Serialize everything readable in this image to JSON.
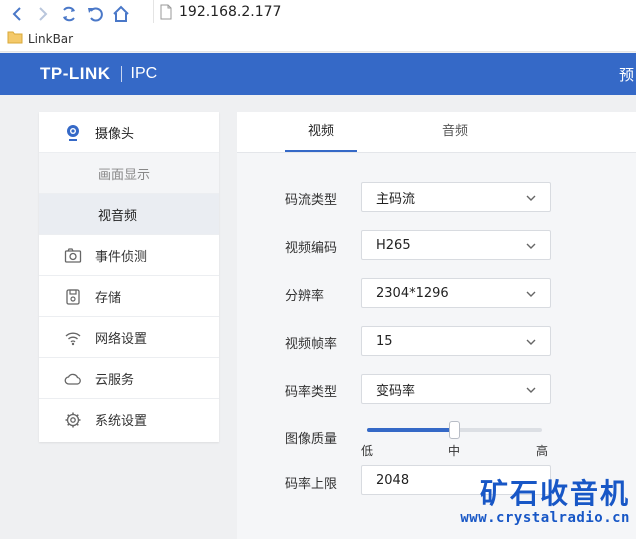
{
  "browser": {
    "url": "192.168.2.177",
    "bookmark_folder": "LinkBar"
  },
  "header": {
    "brand": "TP-LINK",
    "product": "IPC",
    "right_text": "预"
  },
  "sidebar": {
    "items": [
      {
        "label": "摄像头",
        "icon": "camera-icon"
      },
      {
        "label": "画面显示"
      },
      {
        "label": "视音频"
      },
      {
        "label": "事件侦测",
        "icon": "snapshot-camera-icon"
      },
      {
        "label": "存储",
        "icon": "disk-icon"
      },
      {
        "label": "网络设置",
        "icon": "wifi-icon"
      },
      {
        "label": "云服务",
        "icon": "cloud-icon"
      },
      {
        "label": "系统设置",
        "icon": "gear-icon"
      }
    ]
  },
  "tabs": [
    {
      "label": "视频"
    },
    {
      "label": "音频"
    }
  ],
  "form": {
    "stream_type": {
      "label": "码流类型",
      "value": "主码流"
    },
    "video_codec": {
      "label": "视频编码",
      "value": "H265"
    },
    "resolution": {
      "label": "分辨率",
      "value": "2304*1296"
    },
    "frame_rate": {
      "label": "视频帧率",
      "value": "15"
    },
    "bitrate_type": {
      "label": "码率类型",
      "value": "变码率"
    },
    "image_quality": {
      "label": "图像质量",
      "low": "低",
      "mid": "中",
      "high": "高",
      "level": 0.5
    },
    "bitrate_limit": {
      "label": "码率上限",
      "value": "2048"
    }
  },
  "watermark": {
    "title": "矿石收音机",
    "url": "www.crystalradio.cn"
  },
  "colors": {
    "accent": "#3569c7",
    "watermark": "#1857c6"
  }
}
